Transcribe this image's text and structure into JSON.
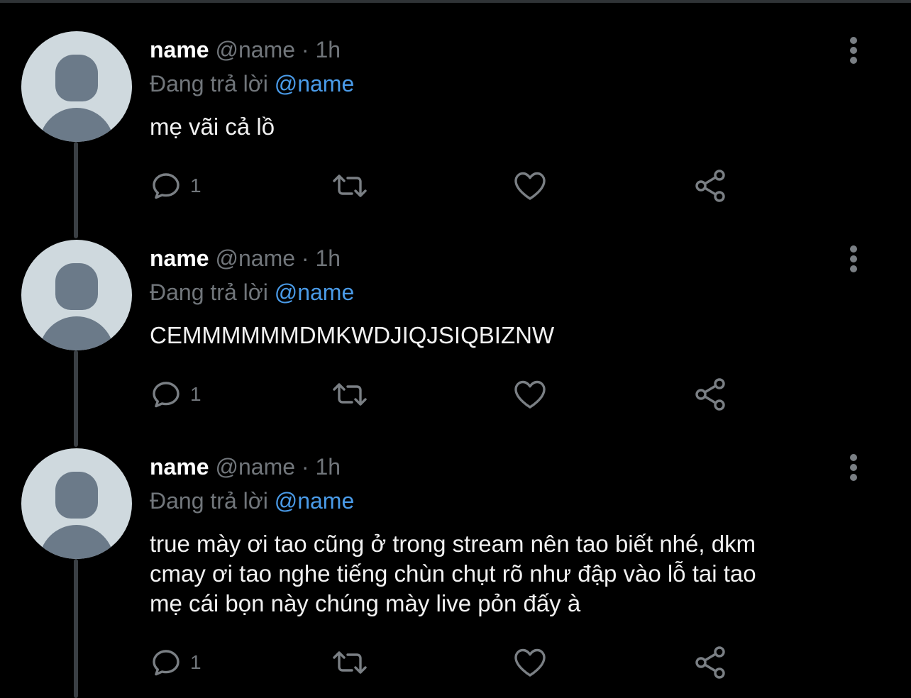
{
  "tweets": [
    {
      "name": "name",
      "handle": "@name",
      "separator": "·",
      "time": "1h",
      "reply_prefix": "Đang trả lời",
      "reply_to": "@name",
      "lines": [
        "mẹ vãi cả lồ"
      ],
      "reply_count": "1"
    },
    {
      "name": "name",
      "handle": "@name",
      "separator": "·",
      "time": "1h",
      "reply_prefix": "Đang trả lời",
      "reply_to": "@name",
      "lines": [
        "CEMMMMMMDMKWDJIQJSIQBIZNW"
      ],
      "reply_count": "1"
    },
    {
      "name": "name",
      "handle": "@name",
      "separator": "·",
      "time": "1h",
      "reply_prefix": "Đang trả lời",
      "reply_to": "@name",
      "lines": [
        "true mày ơi tao cũng ở trong stream nên tao biết nhé, dkm",
        "cmay ơi tao nghe tiếng chùn chụt rõ như đập vào lỗ tai tao",
        "mẹ cái bọn này chúng mày live pỏn đấy à"
      ],
      "reply_count": "1"
    }
  ],
  "icons": {
    "reply": "reply-bubble-icon",
    "retweet": "retweet-icon",
    "like": "heart-icon",
    "share": "share-icon",
    "more": "more-vertical-icon"
  },
  "colors": {
    "background": "#000000",
    "mention": "#4a9be8",
    "secondary_text": "#71767b",
    "avatar_bg": "#cfd9de",
    "avatar_fg": "#6b7a89"
  }
}
